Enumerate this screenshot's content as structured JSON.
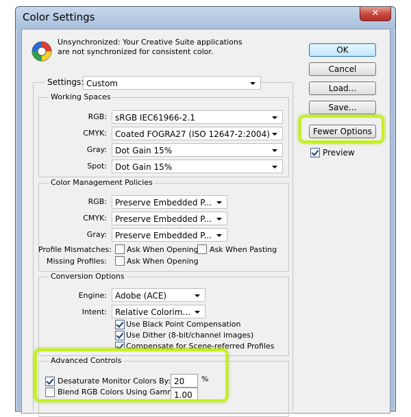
{
  "window": {
    "title": "Color Settings",
    "close_glyph": "✕"
  },
  "sync_message": "Unsynchronized: Your Creative Suite applications are not synchronized for consistent color.",
  "icons": {
    "logo": "color-settings-logo-icon"
  },
  "buttons": {
    "ok": "OK",
    "cancel": "Cancel",
    "load": "Load...",
    "save": "Save...",
    "fewer": "Fewer Options",
    "preview": "Preview"
  },
  "settings": {
    "label": "Settings:",
    "value": "Custom"
  },
  "working_spaces": {
    "title": "Working Spaces",
    "rgb": {
      "label": "RGB:",
      "value": "sRGB IEC61966-2.1"
    },
    "cmyk": {
      "label": "CMYK:",
      "value": "Coated FOGRA27 (ISO 12647-2:2004)"
    },
    "gray": {
      "label": "Gray:",
      "value": "Dot Gain 15%"
    },
    "spot": {
      "label": "Spot:",
      "value": "Dot Gain 15%"
    }
  },
  "policies": {
    "title": "Color Management Policies",
    "rgb": {
      "label": "RGB:",
      "value": "Preserve Embedded P..."
    },
    "cmyk": {
      "label": "CMYK:",
      "value": "Preserve Embedded P..."
    },
    "gray": {
      "label": "Gray:",
      "value": "Preserve Embedded P..."
    },
    "mismatch_label": "Profile Mismatches:",
    "ask_open": "Ask When Opening",
    "ask_paste": "Ask When Pasting",
    "missing_label": "Missing Profiles:",
    "missing_ask_open": "Ask When Opening"
  },
  "conversion": {
    "title": "Conversion Options",
    "engine": {
      "label": "Engine:",
      "value": "Adobe (ACE)"
    },
    "intent": {
      "label": "Intent:",
      "value": "Relative Colorim..."
    },
    "bpc": "Use Black Point Compensation",
    "dither": "Use Dither (8-bit/channel images)",
    "scene": "Compensate for Scene-referred Profiles"
  },
  "advanced": {
    "title": "Advanced Controls",
    "desaturate": {
      "label": "Desaturate Monitor Colors By:",
      "value": "20",
      "unit": "%"
    },
    "blend": {
      "label": "Blend RGB Colors Using Gamma:",
      "value": "1.00"
    }
  },
  "colors": {
    "highlight": "#c6f01c",
    "title_bar": "#a9c0dc",
    "dialog_bg": "#f0f0f0",
    "default_button": "#bee6fd"
  }
}
